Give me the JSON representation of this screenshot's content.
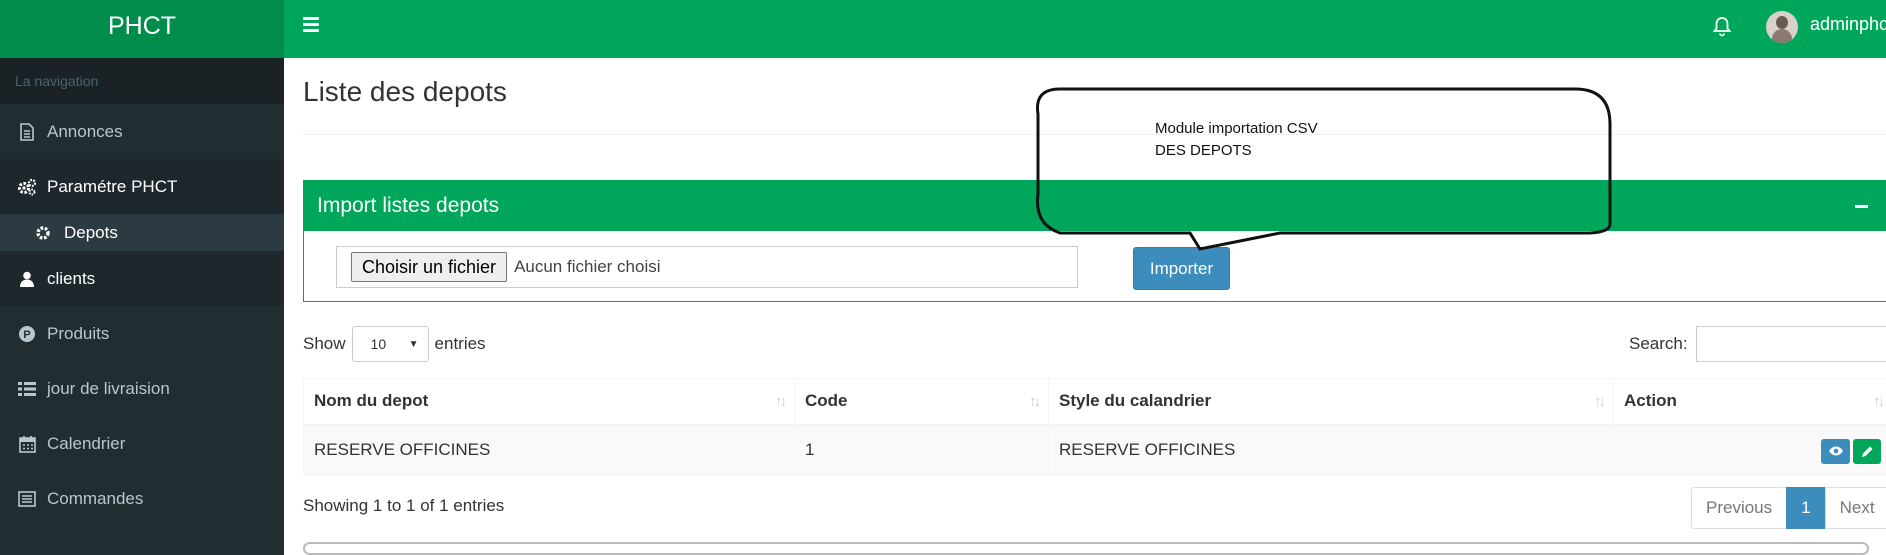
{
  "brand": "PHCT",
  "user": {
    "name": "adminphct"
  },
  "sidebar": {
    "header": "La navigation",
    "items": [
      {
        "label": "Annonces",
        "icon": "file-text-icon"
      },
      {
        "label": "Paramétre PHCT",
        "icon": "cogs-icon"
      },
      {
        "label": "Depots",
        "icon": "gear-icon",
        "sub": true
      },
      {
        "label": "clients",
        "icon": "user-icon"
      },
      {
        "label": "Produits",
        "icon": "product-p-icon"
      },
      {
        "label": "jour de livraision",
        "icon": "list-icon"
      },
      {
        "label": "Calendrier",
        "icon": "calendar-icon"
      },
      {
        "label": "Commandes",
        "icon": "orders-icon"
      }
    ]
  },
  "page": {
    "title": "Liste des depots"
  },
  "callout": {
    "line1": "Module importation CSV",
    "line2": "DES DEPOTS"
  },
  "import_box": {
    "title": "Import listes depots",
    "file_button": "Choisir un fichier",
    "file_status": "Aucun fichier choisi",
    "submit": "Importer"
  },
  "table_controls": {
    "show": "Show",
    "entries_value": "10",
    "entries": "entries",
    "search_label": "Search:"
  },
  "table": {
    "headers": [
      "Nom du depot",
      "Code",
      "Style du calandrier",
      "Action"
    ],
    "rows": [
      {
        "nom": "RESERVE OFFICINES",
        "code": "1",
        "style": "RESERVE OFFICINES"
      }
    ]
  },
  "footer": {
    "info": "Showing 1 to 1 of 1 entries",
    "previous": "Previous",
    "page": "1",
    "next": "Next"
  },
  "colors": {
    "primary": "#00a65a",
    "primary_dark": "#008d4c",
    "sidebar": "#222d32",
    "blue": "#3c8dbc"
  }
}
